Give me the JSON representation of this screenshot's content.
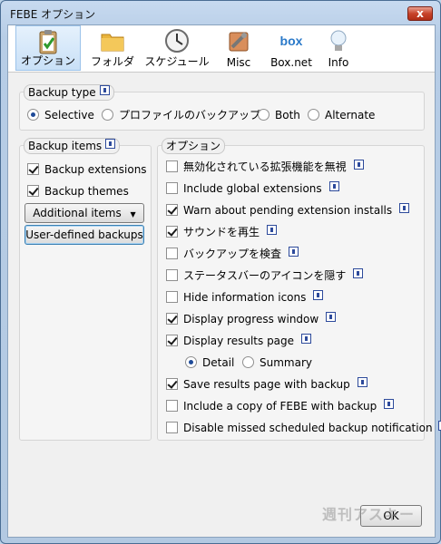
{
  "window": {
    "title": "FEBE オプション",
    "close_label": "x"
  },
  "toolbar": {
    "tabs": [
      {
        "label": "オプション",
        "icon": "clipboard-check-icon"
      },
      {
        "label": "フォルダ",
        "icon": "folder-icon"
      },
      {
        "label": "スケジュール",
        "icon": "clock-icon"
      },
      {
        "label": "Misc",
        "icon": "tools-icon"
      },
      {
        "label": "Box.net",
        "icon": "box-logo-icon",
        "logo_text": "box"
      },
      {
        "label": "Info",
        "icon": "lightbulb-icon"
      }
    ],
    "selected": "オプション"
  },
  "backup_type": {
    "title": "Backup type",
    "options": [
      "Selective",
      "プロファイルのバックアップ",
      "Both",
      "Alternate"
    ],
    "selected": "Selective"
  },
  "backup_items": {
    "title": "Backup items",
    "extensions": {
      "label": "Backup extensions",
      "checked": true
    },
    "themes": {
      "label": "Backup themes",
      "checked": true
    },
    "additional_items_label": "Additional items",
    "user_defined_label": "User-defined backups"
  },
  "options": {
    "title": "オプション",
    "items": [
      {
        "label": "無効化されている拡張機能を無視",
        "checked": false
      },
      {
        "label": "Include global extensions",
        "checked": false
      },
      {
        "label": "Warn about pending extension installs",
        "checked": true
      },
      {
        "label": "サウンドを再生",
        "checked": true
      },
      {
        "label": "バックアップを検査",
        "checked": false
      },
      {
        "label": "ステータスバーのアイコンを隠す",
        "checked": false
      },
      {
        "label": "Hide information icons",
        "checked": false
      },
      {
        "label": "Display progress window",
        "checked": true
      },
      {
        "label": "Display results page",
        "checked": true
      }
    ],
    "results_mode": {
      "options": [
        "Detail",
        "Summary"
      ],
      "selected": "Detail"
    },
    "items_after": [
      {
        "label": "Save results page with backup",
        "checked": true
      },
      {
        "label": "Include a copy of FEBE with backup",
        "checked": false
      },
      {
        "label": "Disable missed scheduled backup notification",
        "checked": false
      }
    ]
  },
  "footer": {
    "ok_label": "OK",
    "watermark": "週刊アスキー"
  }
}
